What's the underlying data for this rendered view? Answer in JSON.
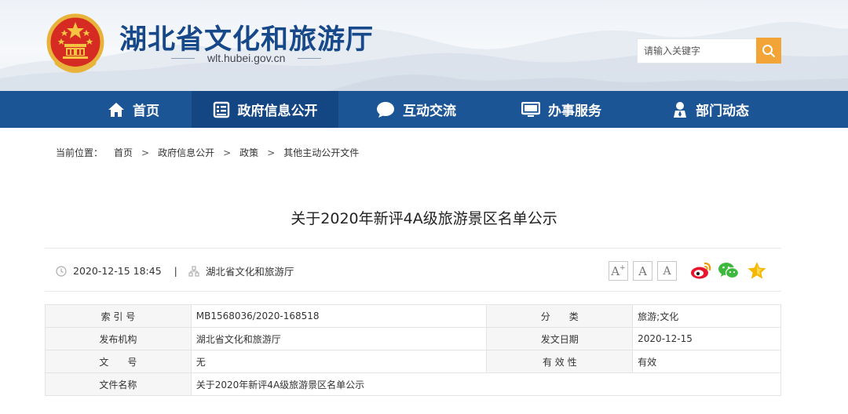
{
  "header": {
    "site_title": "湖北省文化和旅游厅",
    "site_url": "wlt.hubei.gov.cn",
    "search_placeholder": "请输入关键字"
  },
  "nav": {
    "items": [
      {
        "label": "首页",
        "icon": "home-icon"
      },
      {
        "label": "政府信息公开",
        "icon": "document-list-icon",
        "active": true
      },
      {
        "label": "互动交流",
        "icon": "chat-bubble-icon"
      },
      {
        "label": "办事服务",
        "icon": "monitor-icon"
      },
      {
        "label": "部门动态",
        "icon": "person-badge-icon"
      }
    ]
  },
  "breadcrumb": {
    "prefix": "当前位置：",
    "items": [
      "首页",
      "政府信息公开",
      "政策",
      "其他主动公开文件"
    ],
    "separator": ">"
  },
  "article": {
    "title": "关于2020年新评4A级旅游景区名单公示",
    "datetime": "2020-12-15 18:45",
    "divider": "|",
    "source": "湖北省文化和旅游厅"
  },
  "font_size_buttons": {
    "large": "A",
    "large_sup": "+",
    "medium": "A",
    "small": "A"
  },
  "share": [
    "weibo-icon",
    "wechat-icon",
    "favorite-star-icon"
  ],
  "info_table": {
    "rows": [
      {
        "label1": "索 引 号",
        "value1": "MB1568036/2020-168518",
        "label2": "分　　类",
        "value2": "旅游;文化"
      },
      {
        "label1": "发布机构",
        "value1": "湖北省文化和旅游厅",
        "label2": "发文日期",
        "value2": "2020-12-15"
      },
      {
        "label1": "文　　号",
        "value1": "无",
        "label2": "有 效 性",
        "value2": "有效"
      },
      {
        "label1": "文件名称",
        "value1": "关于2020年新评4A级旅游景区名单公示"
      }
    ]
  },
  "colors": {
    "nav_bg": "#1b5596",
    "nav_active": "#134682",
    "title_blue": "#17488a",
    "search_btn": "#f3a436"
  }
}
